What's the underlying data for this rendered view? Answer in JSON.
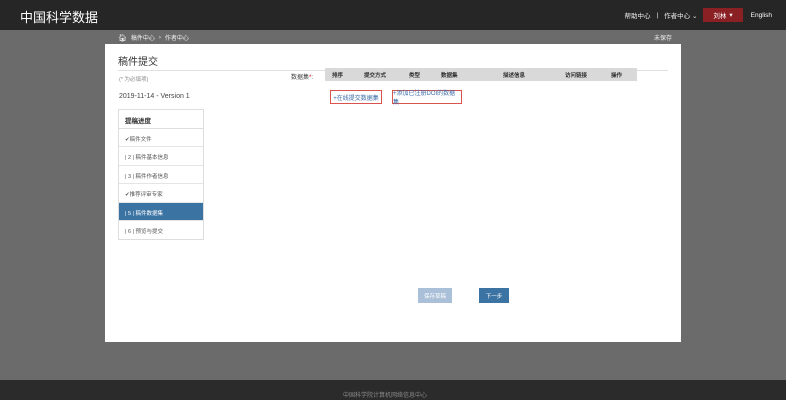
{
  "header": {
    "logo": "中国科学数据",
    "nav": {
      "help": "帮助中心",
      "author_center": "作者中心",
      "user": "刘林",
      "language": "English"
    }
  },
  "breadcrumb": {
    "home_icon": "home-icon",
    "items": [
      "稿件中心",
      "作者中心"
    ],
    "separator": "›"
  },
  "status": {
    "unsaved": "未保存"
  },
  "page": {
    "title": "稿件提交",
    "required_note": "(* 为必填项)",
    "version": "2019-11-14 - Version 1"
  },
  "steps": {
    "header": "提稿进度",
    "items": [
      {
        "label": "✔稿件文件",
        "active": false
      },
      {
        "label": "| 2 | 稿件基本信息",
        "active": false
      },
      {
        "label": "| 3 | 稿件作者信息",
        "active": false
      },
      {
        "label": "✔推荐评审专家",
        "active": false
      },
      {
        "label": "| 5 | 稿件数据集",
        "active": true
      },
      {
        "label": "| 6 | 预览与提交",
        "active": false
      }
    ]
  },
  "dataset": {
    "label": "数据集",
    "required_mark": "*",
    "columns": [
      "排序",
      "提交方式",
      "类型",
      "数据集",
      "描述信息",
      "访问链接",
      "操作"
    ],
    "buttons": {
      "add_online": "+在线提交数据集",
      "add_registered": "+添加已注册DOI的数据集"
    }
  },
  "actions": {
    "save_draft": "保存草稿",
    "next": "下一步"
  },
  "footer": {
    "text": "中国科学院计算机网络信息中心"
  },
  "colors": {
    "topbar": "#262626",
    "accent_red": "#8a1f24",
    "active_blue": "#3b73a3",
    "button_outline": "#d9534f"
  }
}
